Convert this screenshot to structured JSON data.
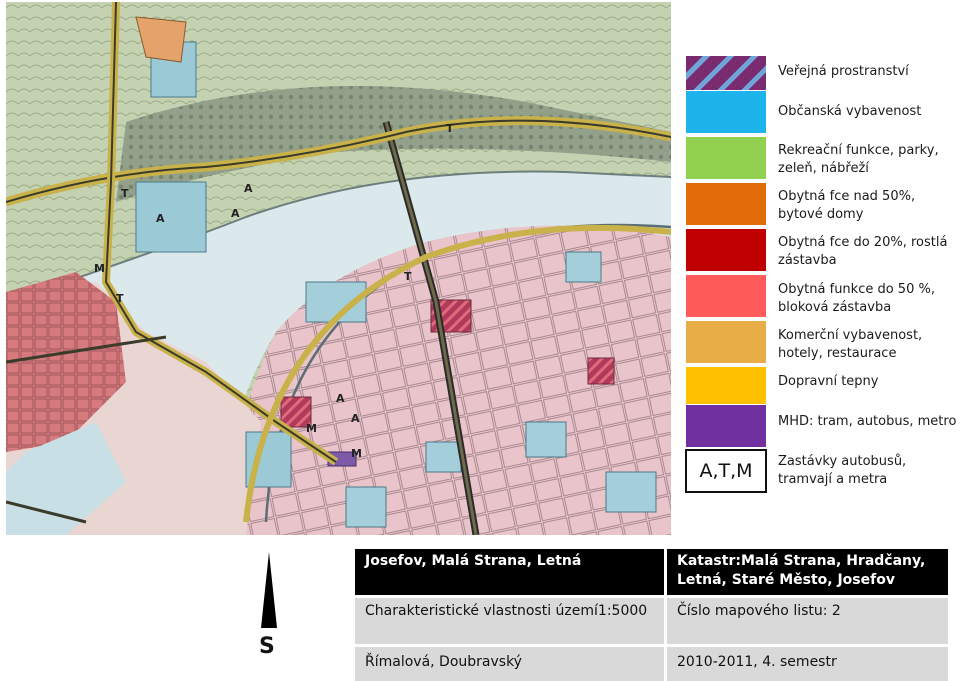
{
  "legend": {
    "items": [
      {
        "label": "Veřejná prostranství",
        "color": "#7a2a6e",
        "hatch": "#6fa5d8"
      },
      {
        "label": "Občanská vybavenost",
        "color": "#1cb4ea"
      },
      {
        "label": "Rekreační funkce, parky, zeleň, nábřeží",
        "color": "#92d050"
      },
      {
        "label": "Obytná fce nad 50%, bytové domy",
        "color": "#e36c0a"
      },
      {
        "label": "Obytná fce do 20%, rostlá zástavba",
        "color": "#c00000"
      },
      {
        "label": "Obytná funkce do 50 %, bloková zástavba",
        "color": "#ff5b5b"
      },
      {
        "label": "Komerční vybavenost, hotely, restaurace",
        "color": "#e8ad46"
      },
      {
        "label": "Dopravní tepny",
        "color": "#ffc000"
      },
      {
        "label": "MHD: tram, autobus, metro",
        "color": "#7030a0"
      },
      {
        "label": "Zastávky autobusů, tramvají a metra",
        "abbr": "A,T,M"
      }
    ]
  },
  "north_arrow": {
    "label": "S"
  },
  "info_table": {
    "district": "Josefov, Malá Strana, Letná",
    "cadastre": "Katastr:Malá Strana, Hradčany, Letná, Staré Město, Josefov",
    "subject": "Charakteristické vlastnosti území1:5000",
    "sheet": "Číslo mapového listu: 2",
    "authors": "Římalová, Doubravský",
    "term": "2010-2011, 4. semestr"
  },
  "map": {
    "stop_labels": [
      "A",
      "T",
      "A",
      "M",
      "T",
      "A",
      "A",
      "M",
      "T",
      "A",
      "T",
      "M"
    ]
  }
}
